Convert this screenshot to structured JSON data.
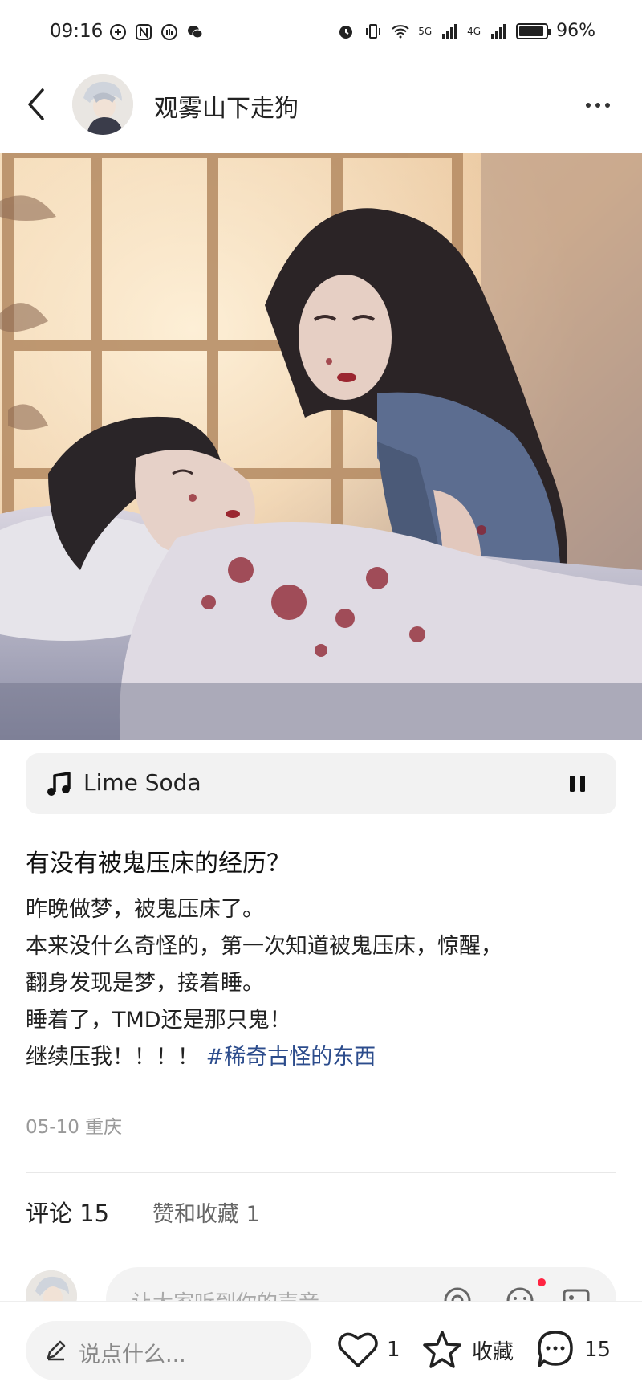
{
  "status_bar": {
    "time": "09:16",
    "battery": "96%",
    "network_1": "5G",
    "network_2": "4G"
  },
  "header": {
    "author_name": "观雾山下走狗"
  },
  "music": {
    "title": "Lime Soda"
  },
  "post": {
    "title": "有没有被鬼压床的经历？",
    "body_lines": [
      "昨晚做梦，被鬼压床了。",
      "本来没什么奇怪的，第一次知道被鬼压床，惊醒，",
      "翻身发现是梦，接着睡。",
      "睡着了，TMD还是那只鬼！",
      "继续压我！！！！"
    ],
    "hashtag": "#稀奇古怪的东西",
    "date": "05-10",
    "location": "重庆"
  },
  "tabs": {
    "comments": "评论 15",
    "likes_collects": "赞和收藏 1"
  },
  "comment_input": {
    "placeholder": "让大家听到你的声音"
  },
  "bottom_bar": {
    "say_placeholder": "说点什么...",
    "like_count": "1",
    "collect_label": "收藏",
    "comment_count": "15"
  },
  "colors": {
    "hashtag": "#2c4c8c",
    "notification_dot": "#ff2442"
  }
}
